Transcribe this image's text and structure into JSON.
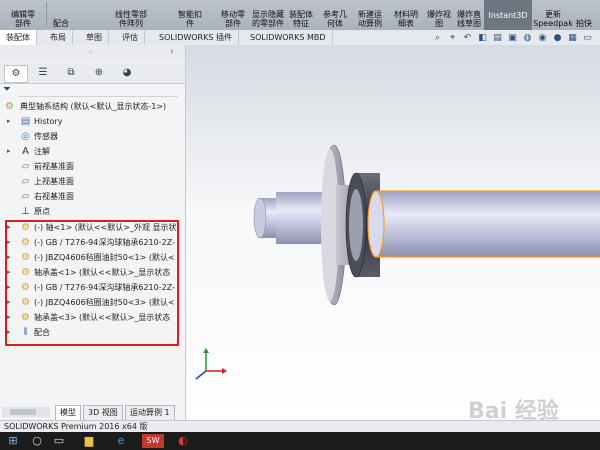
{
  "ribbon": {
    "buttons": [
      {
        "l1": "编辑零",
        "l2": "部件"
      },
      {
        "l1": "",
        "l2": "配合"
      },
      {
        "l1": "线性零部",
        "l2": "件阵列"
      },
      {
        "l1": "智能扣",
        "l2": "件"
      },
      {
        "l1": "移动零",
        "l2": "部件"
      },
      {
        "l1": "显示隐藏",
        "l2": "的零部件"
      },
      {
        "l1": "装配体",
        "l2": "特征"
      },
      {
        "l1": "参考几",
        "l2": "何体"
      },
      {
        "l1": "新建运",
        "l2": "动算例"
      },
      {
        "l1": "材料明",
        "l2": "细表"
      },
      {
        "l1": "爆炸视",
        "l2": "图"
      },
      {
        "l1": "爆炸直",
        "l2": "线草图"
      },
      {
        "l1": "更新",
        "l2": "Speedpak"
      },
      {
        "l1": "拍快",
        "l2": ""
      }
    ],
    "instant3d": "Instant3D"
  },
  "tabs": [
    "装配体",
    "布局",
    "草图",
    "评估",
    "SOLIDWORKS 插件",
    "SOLIDWORKS MBD"
  ],
  "tree": {
    "rows": [
      {
        "label": "典型轴系结构 (默认<默认_显示状态-1>)"
      },
      {
        "label": "History"
      },
      {
        "label": "传感器"
      },
      {
        "label": "注解"
      },
      {
        "label": "前视基准面"
      },
      {
        "label": "上视基准面"
      },
      {
        "label": "右视基准面"
      },
      {
        "label": "原点"
      },
      {
        "label": "(-) 轴<1> (默认<<默认>_外观 显示状"
      },
      {
        "label": "(-) GB / T276-94深沟球轴承6210-2Z-"
      },
      {
        "label": "(-) JBZQ4606毡圈油封50<1> (默认<"
      },
      {
        "label": "轴承盖<1> (默认<<默认>_显示状态"
      },
      {
        "label": "(-) GB / T276-94深沟球轴承6210-2Z-"
      },
      {
        "label": "(-) JBZQ4606毡圈油封50<3> (默认<"
      },
      {
        "label": "轴承盖<3> (默认<<默认>_显示状态"
      },
      {
        "label": "配合"
      }
    ]
  },
  "bottom_tabs": [
    "模型",
    "3D 视图",
    "运动算例 1"
  ],
  "status": "SOLIDWORKS Premium 2016 x64 版",
  "watermark": "Bai 经验",
  "colors": {
    "highlight": "#e11b1b",
    "shaft": "#b9bdd8",
    "edge": "#ff9a1a"
  }
}
